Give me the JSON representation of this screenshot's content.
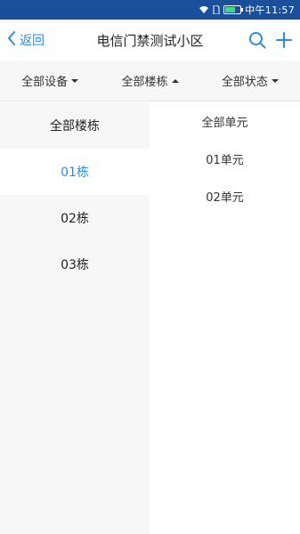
{
  "status_bar": {
    "time": "中午11:57",
    "icons": [
      "wifi-icon",
      "sim-icon",
      "battery-icon"
    ]
  },
  "nav": {
    "back_label": "返回",
    "title": "电信门禁测试小区",
    "actions": [
      "search-icon",
      "add-icon"
    ]
  },
  "filters": [
    {
      "label": "全部设备",
      "caret": "down"
    },
    {
      "label": "全部楼栋",
      "caret": "up"
    },
    {
      "label": "全部状态",
      "caret": "down"
    }
  ],
  "buildings": [
    "全部楼栋",
    "01栋",
    "02栋",
    "03栋"
  ],
  "selected_building": "01栋",
  "units": [
    "全部单元",
    "01单元",
    "02单元"
  ],
  "colors": {
    "status_bar": "#1a4f9c",
    "accent": "#2b8ce8",
    "left_pane_bg": "#f7f7f7"
  }
}
